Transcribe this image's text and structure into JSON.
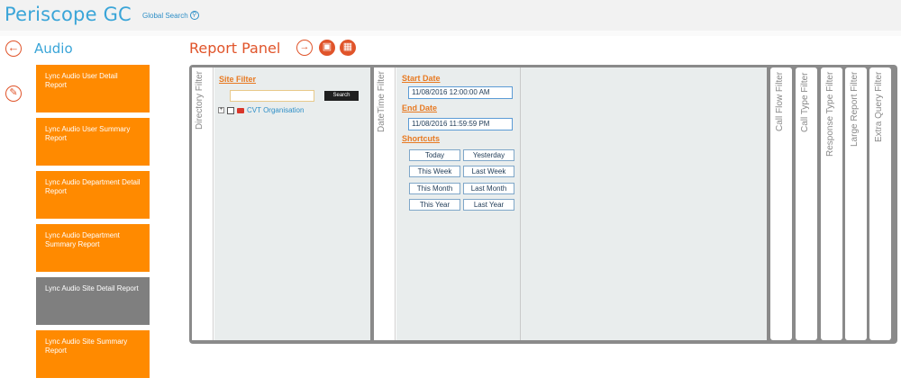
{
  "app": {
    "title": "Periscope GC",
    "global_search_label": "Global Search"
  },
  "nav": {
    "section_title": "Audio"
  },
  "reports": [
    {
      "label": "Lync Audio User Detail Report",
      "active": false
    },
    {
      "label": "Lync Audio User Summary Report",
      "active": false
    },
    {
      "label": "Lync Audio Department Detail Report",
      "active": false
    },
    {
      "label": "Lync Audio Department Summary Report",
      "active": false
    },
    {
      "label": "Lync Audio Site Detail Report",
      "active": true
    },
    {
      "label": "Lync Audio Site Summary Report",
      "active": false
    }
  ],
  "panel": {
    "title": "Report Panel",
    "directory_filter": {
      "tab_label": "Directory Filter",
      "site_filter_label": "Site Filter",
      "search_value": "",
      "search_button": "Search",
      "tree_root": "CVT Organisation"
    },
    "datetime_filter": {
      "tab_label": "DateTime Filter",
      "start_label": "Start Date",
      "start_value": "11/08/2016 12:00:00 AM",
      "end_label": "End Date",
      "end_value": "11/08/2016 11:59:59 PM",
      "shortcuts_label": "Shortcuts",
      "shortcuts": [
        "Today",
        "Yesterday",
        "This Week",
        "Last Week",
        "This Month",
        "Last Month",
        "This Year",
        "Last Year"
      ]
    },
    "collapsed_filters": [
      "Call Flow Filter",
      "Call Type Filter",
      "Response Type Filter",
      "Large Report Filter",
      "Extra Query Filter"
    ]
  },
  "icons": {
    "back": "arrow-left-icon",
    "edit": "pencil-icon",
    "run": "arrow-right-icon",
    "save": "save-icon",
    "schedule": "calendar-icon",
    "search": "magnifier-icon"
  },
  "colors": {
    "brand_blue": "#3aa5d8",
    "accent_orange": "#e0542a",
    "tile_orange": "#ff8a00",
    "tile_active": "#7f7f7f"
  }
}
